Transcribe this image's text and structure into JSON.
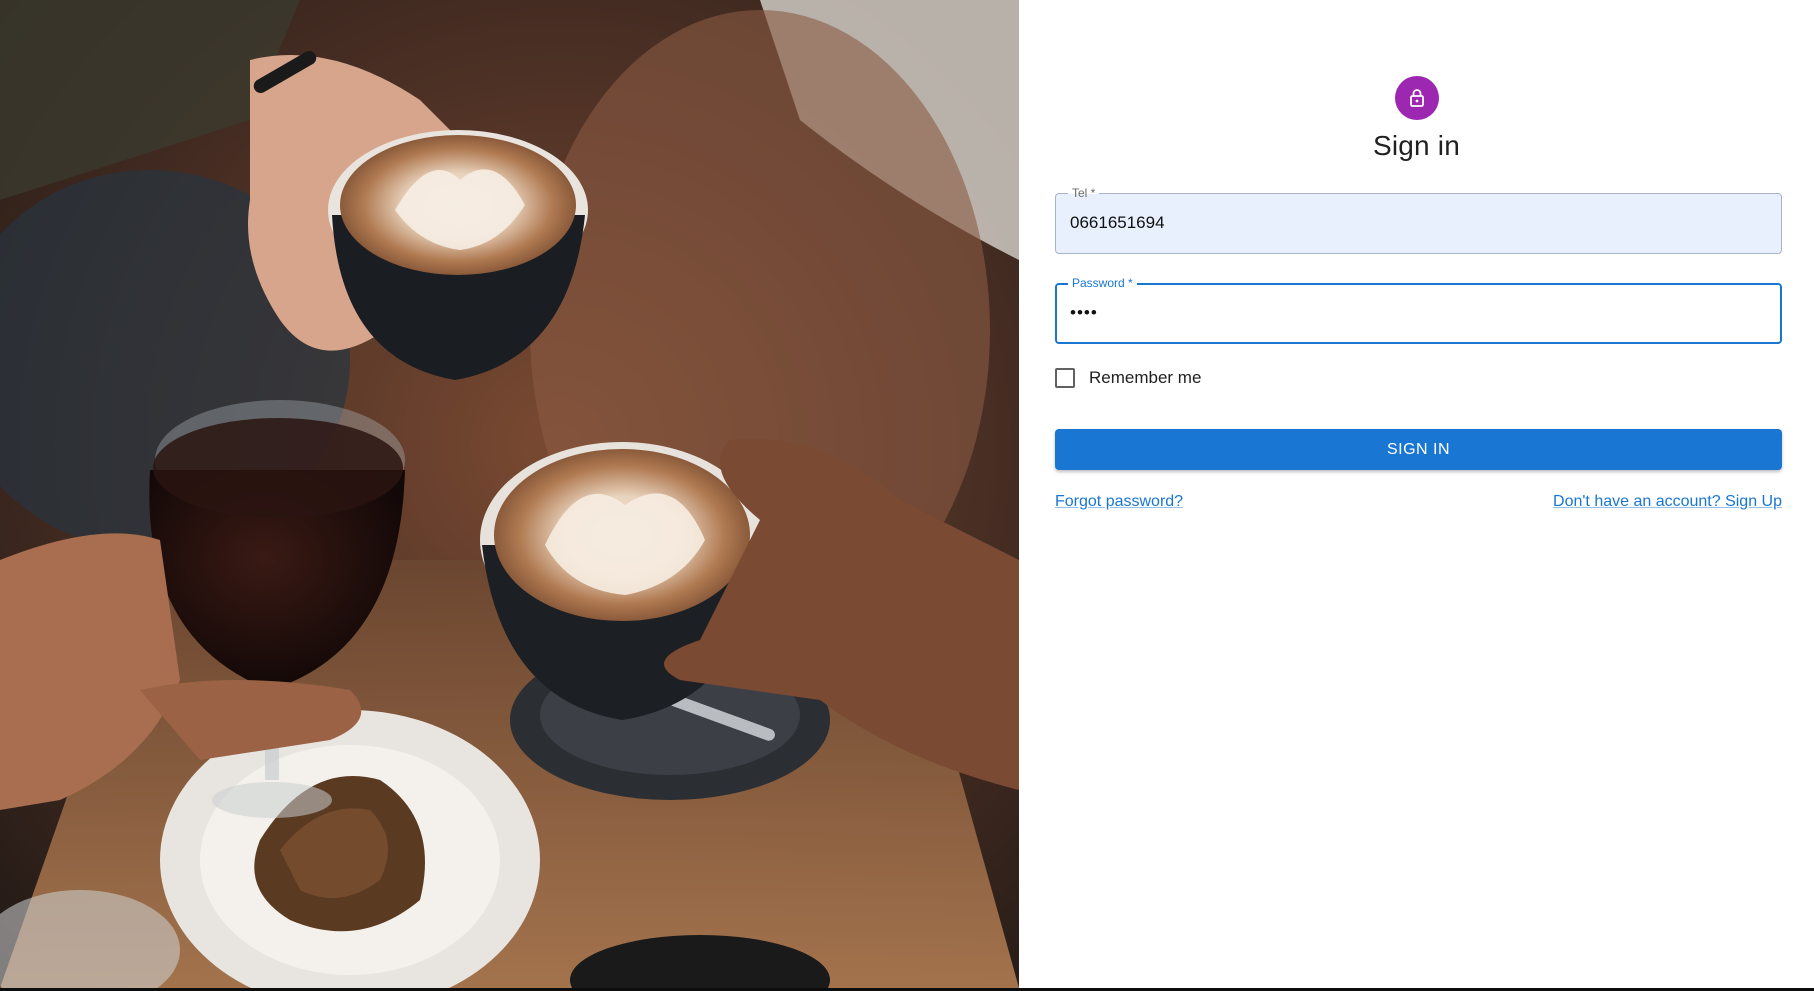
{
  "hero": {
    "image_description_icon": "coffee-cheers-photo"
  },
  "signin": {
    "avatar_icon": "lock-icon",
    "avatar_color": "#9c27b0",
    "title": "Sign in",
    "tel": {
      "label": "Tel *",
      "value": "0661651694"
    },
    "password": {
      "label": "Password *",
      "value": "••••"
    },
    "remember_label": "Remember me",
    "remember_checked": false,
    "submit_label": "SIGN IN",
    "forgot_link": "Forgot password?",
    "signup_link": "Don't have an account? Sign Up",
    "accent_color": "#1976d2"
  }
}
